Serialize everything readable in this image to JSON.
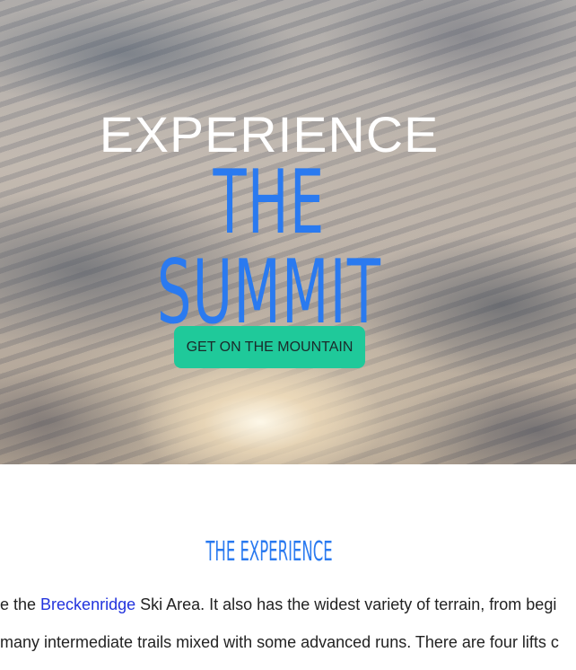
{
  "hero": {
    "line1": "EXPERIENCE",
    "line2": "THE SUMMIT",
    "cta_label": "GET ON THE MOUNTAIN"
  },
  "experience": {
    "title": "THE EXPERIENCE",
    "para1_before": "e the ",
    "para1_link": "Breckenridge",
    "para1_after": " Ski Area. It also has the widest variety of terrain, from begi",
    "para2": "many intermediate trails mixed with some advanced runs. There are four lifts c"
  },
  "colors": {
    "accent_blue": "#2a7af0",
    "cta_green": "#1fc99a",
    "link_blue": "#2233dd"
  }
}
